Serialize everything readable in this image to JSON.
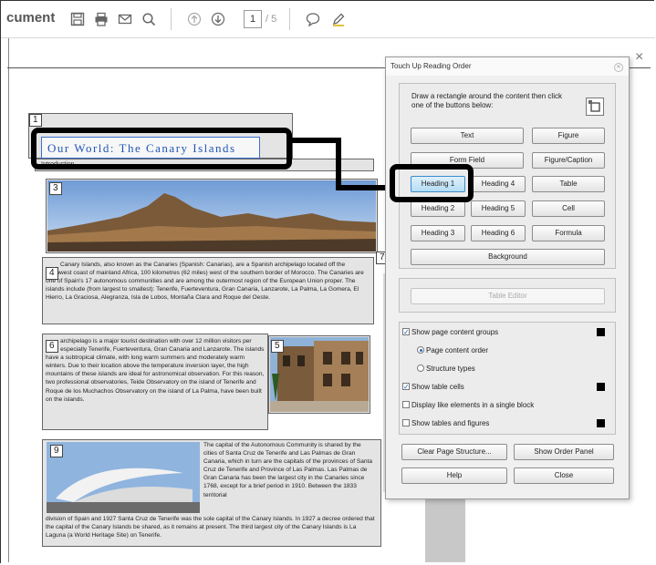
{
  "toolbar": {
    "title": "cument",
    "current_page": "1",
    "total_pages": "/ 5"
  },
  "document": {
    "heading": "Our World: The Canary Islands",
    "intro_label": "Introduction",
    "block_numbers": {
      "b1": "1",
      "b3": "3",
      "b4": "4",
      "b5": "5",
      "b6": "6",
      "b7": "7",
      "b9": "9"
    },
    "para1": "Canary Islands, also known as the Canaries (Spanish: Canarias), are a Spanish archipelago located off the northwest coast of mainland Africa, 100 kilometres (62 miles) west of the southern border of Morocco. The Canaries are one of Spain's 17 autonomous communities and are among the outermost region of the European Union proper. The islands include (from largest to smallest): Tenerife, Fuerteventura, Gran Canaria, Lanzarote, La Palma, La Gomera, El Hierro, La Graciosa, Alegranza, Isla de Lobos, Montaña Clara and Roque del Oeste.",
    "para2": "archipelago is a major tourist destination with over 12 million visitors per year, especially Tenerife, Fuerteventura, Gran Canaria and Lanzarote. The islands have a subtropical climate, with long warm summers and moderately warm winters. Due to their location above the temperature inversion layer, the high mountains of these islands are ideal for astronomical observation. For this reason, two professional observatories, Teide Observatory on the island of Tenerife and Roque de los Muchachos Observatory on the island of La Palma, have been built on the islands.",
    "para3": "The capital of the Autonomous Community is shared by the cities of Santa Cruz de Tenerife and Las Palmas de Gran Canaria, which in turn are the capitals of the provinces of Santa Cruz de Tenerife and Province of Las Palmas. Las Palmas de Gran Canaria has been the largest city in the Canaries since 1768, except for a brief period in 1910. Between the 1833 territorial",
    "para3b": "division of Spain and 1927 Santa Cruz de Tenerife was the sole capital of the Canary Islands. In 1927 a decree ordered that the capital of the Canary Islands be shared, as it remains at present. The third largest city of the Canary Islands is La Laguna (a World Heritage Site) on Tenerife."
  },
  "dialog": {
    "title": "Touch Up Reading Order",
    "instructions": "Draw a rectangle around the content then click one of the buttons below:",
    "buttons": {
      "text": "Text",
      "figure": "Figure",
      "form_field": "Form Field",
      "figure_caption": "Figure/Caption",
      "heading1": "Heading 1",
      "heading4": "Heading 4",
      "table": "Table",
      "heading2": "Heading 2",
      "heading5": "Heading 5",
      "cell": "Cell",
      "heading3": "Heading 3",
      "heading6": "Heading 6",
      "formula": "Formula",
      "background": "Background",
      "table_editor": "Table Editor",
      "clear_structure": "Clear Page Structure...",
      "show_order_panel": "Show Order Panel",
      "help": "Help",
      "close": "Close"
    },
    "options": {
      "show_groups": "Show page content groups",
      "content_order": "Page content order",
      "structure_types": "Structure types",
      "show_cells": "Show table cells",
      "like_elements": "Display like elements in a single block",
      "tables_figures": "Show tables and figures"
    }
  },
  "colors": {
    "highlight_blue": "#3b6fd0",
    "callout_black": "#000000",
    "active_button": "#b3dcf5"
  }
}
